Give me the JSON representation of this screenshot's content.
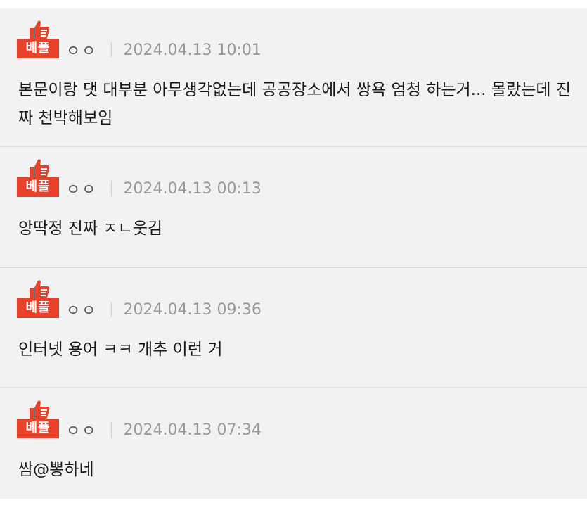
{
  "best_badge_label": "베플",
  "colors": {
    "badge": "#e8412c",
    "card_background": "#f2f2f2",
    "divider": "#dedede"
  },
  "badge_icon": "thumbs-up-icon",
  "comments": [
    {
      "username": "ㅇㅇ",
      "timestamp": "2024.04.13 10:01",
      "text": "본문이랑 댓 대부분 아무생각없는데 공공장소에서 쌍욕 엄청 하는거... 몰랐는데 진짜 천박해보임"
    },
    {
      "username": "ㅇㅇ",
      "timestamp": "2024.04.13 00:13",
      "text": "앙딱정 진짜 ㅈㄴ웃김"
    },
    {
      "username": "ㅇㅇ",
      "timestamp": "2024.04.13 09:36",
      "text": "인터넷 용어 ㅋㅋ 개추 이런 거"
    },
    {
      "username": "ㅇㅇ",
      "timestamp": "2024.04.13 07:34",
      "text": "쌈@뽕하네"
    }
  ]
}
